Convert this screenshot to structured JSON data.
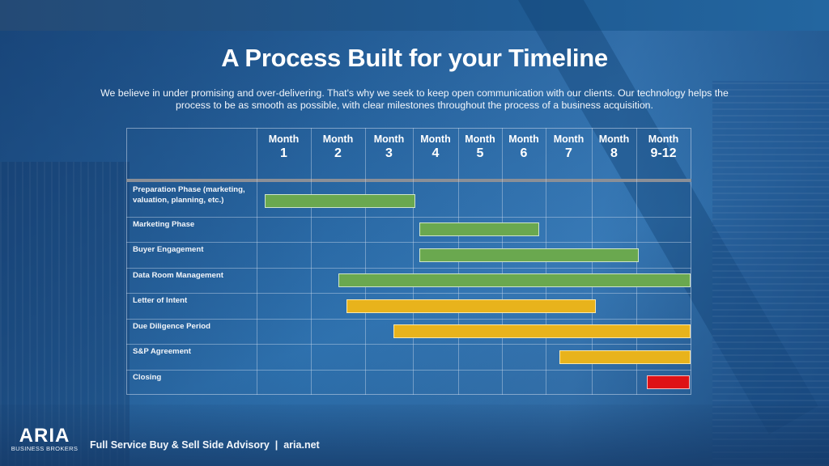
{
  "title": "A Process Built for your Timeline",
  "subtitle": "We believe in under promising and over-delivering. That's why we seek to keep open communication with our clients. Our technology helps the process to be as smooth as possible, with clear milestones throughout the process of a business acquisition.",
  "colors": {
    "green": "#6aa84f",
    "yellow": "#e8b31c",
    "red": "#de1216",
    "background": "#1f5a92"
  },
  "chart_data": {
    "type": "gantt",
    "title": "A Process Built for your Timeline",
    "columns": [
      {
        "label": "Month",
        "num": "1"
      },
      {
        "label": "Month",
        "num": "2"
      },
      {
        "label": "Month",
        "num": "3"
      },
      {
        "label": "Month",
        "num": "4"
      },
      {
        "label": "Month",
        "num": "5"
      },
      {
        "label": "Month",
        "num": "6"
      },
      {
        "label": "Month",
        "num": "7"
      },
      {
        "label": "Month",
        "num": "8"
      },
      {
        "label": "Month",
        "num": "9-12"
      }
    ],
    "tasks": [
      {
        "label": "Preparation Phase (marketing, valuation, planning, etc.)",
        "start": 0.15,
        "end": 3.05,
        "color": "green"
      },
      {
        "label": "Marketing Phase",
        "start": 3.15,
        "end": 5.85,
        "color": "green"
      },
      {
        "label": "Buyer Engagement",
        "start": 3.15,
        "end": 8.05,
        "color": "green"
      },
      {
        "label": "Data Room Management",
        "start": 1.5,
        "end": 9.0,
        "color": "green"
      },
      {
        "label": "Letter of Intent",
        "start": 1.65,
        "end": 7.1,
        "color": "yellow"
      },
      {
        "label": "Due Diligence Period",
        "start": 2.6,
        "end": 9.0,
        "color": "yellow"
      },
      {
        "label": "S&P Agreement",
        "start": 6.3,
        "end": 9.0,
        "color": "yellow"
      },
      {
        "label": "Closing",
        "start": 8.2,
        "end": 8.98,
        "color": "red"
      }
    ]
  },
  "footer": {
    "logo_word": "ARIA",
    "logo_sub": "BUSINESS BROKERS",
    "tagline": "Full Service Buy & Sell Side Advisory  |  aria.net"
  }
}
